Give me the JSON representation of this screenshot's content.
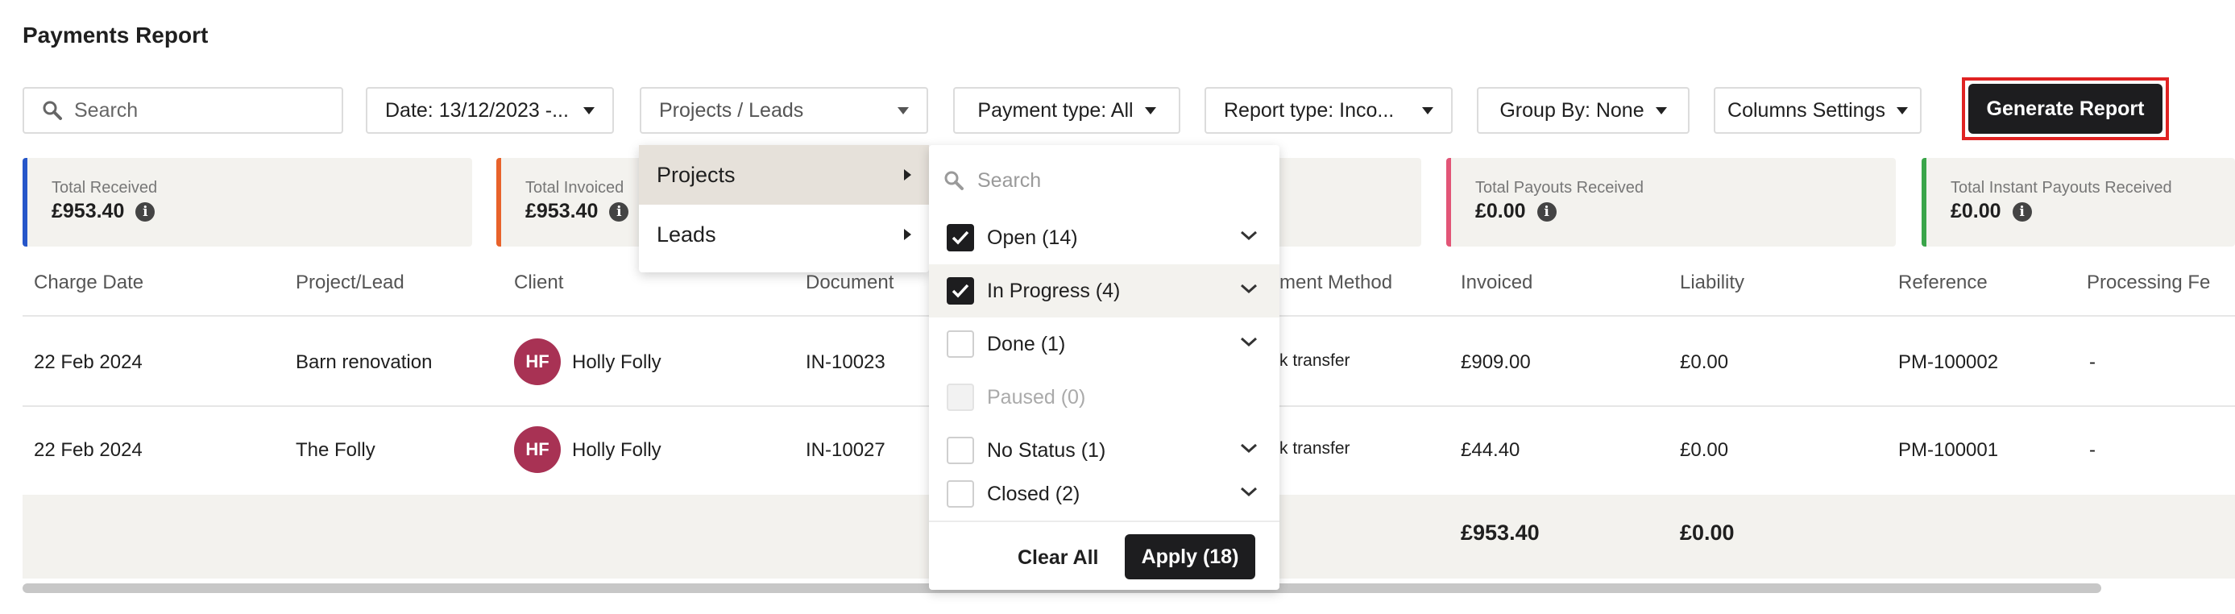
{
  "page": {
    "title": "Payments Report"
  },
  "toolbar": {
    "search_placeholder": "Search",
    "date_filter": "Date: 13/12/2023 -...",
    "projects_filter": "Projects / Leads",
    "payment_type": "Payment type: All",
    "report_type": "Report type: Inco...",
    "group_by": "Group By: None",
    "columns_settings": "Columns Settings",
    "generate_report": "Generate Report"
  },
  "cards": [
    {
      "label": "Total Received",
      "value": "£953.40",
      "color": "#2656c9"
    },
    {
      "label": "Total Invoiced",
      "value": "£953.40",
      "color": "#e8622b"
    },
    {
      "label": "Total Payouts Received",
      "value": "£0.00",
      "color": "#e25577"
    },
    {
      "label": "Total Instant Payouts Received",
      "value": "£0.00",
      "color": "#3aa54a"
    }
  ],
  "table": {
    "headers": [
      "Charge Date",
      "Project/Lead",
      "Client",
      "Document",
      "ment Method",
      "Invoiced",
      "Liability",
      "Reference",
      "Processing Fe"
    ],
    "rows": [
      {
        "charge_date": "22 Feb 2024",
        "project": "Barn renovation",
        "client_initials": "HF",
        "client": "Holly Folly",
        "document": "IN-10023",
        "method": "k transfer",
        "invoiced": "£909.00",
        "liability": "£0.00",
        "reference": "PM-100002",
        "fee": "-"
      },
      {
        "charge_date": "22 Feb 2024",
        "project": "The Folly",
        "client_initials": "HF",
        "client": "Holly Folly",
        "document": "IN-10027",
        "method": "k transfer",
        "invoiced": "£44.40",
        "liability": "£0.00",
        "reference": "PM-100001",
        "fee": "-"
      }
    ],
    "totals": {
      "invoiced": "£953.40",
      "liability": "£0.00"
    }
  },
  "flyout": {
    "items": [
      {
        "label": "Projects"
      },
      {
        "label": "Leads"
      }
    ]
  },
  "panel": {
    "search_placeholder": "Search",
    "options": [
      {
        "label": "Open (14)",
        "checked": true
      },
      {
        "label": "In Progress (4)",
        "checked": true
      },
      {
        "label": "Done (1)",
        "checked": false
      },
      {
        "label": "Paused (0)",
        "checked": false,
        "disabled": true
      },
      {
        "label": "No Status (1)",
        "checked": false
      },
      {
        "label": "Closed (2)",
        "checked": false
      }
    ],
    "clear_all": "Clear All",
    "apply": "Apply (18)"
  }
}
